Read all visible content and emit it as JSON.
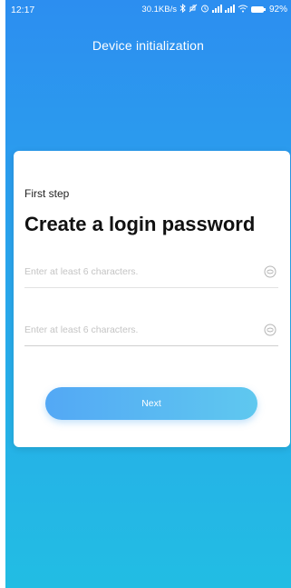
{
  "status_bar": {
    "time": "12:17",
    "network_speed": "30.1KB/s",
    "battery_percent": "92%",
    "icons": [
      "bluetooth-icon",
      "mute-icon",
      "alarm-icon",
      "signal-icon",
      "signal-icon-2",
      "wifi-icon",
      "battery-icon"
    ]
  },
  "header": {
    "title": "Device initialization"
  },
  "card": {
    "step": "First step",
    "title": "Create a login password",
    "password_field": {
      "placeholder": "Enter at least 6 characters.",
      "value": "",
      "icon": "eye-icon"
    },
    "confirm_field": {
      "placeholder": "Enter at least 6 characters.",
      "value": "",
      "icon": "eye-icon"
    },
    "next_label": "Next"
  },
  "colors": {
    "gradient_top": "#2c8ef0",
    "gradient_bottom": "#22bde3",
    "button_start": "#53a8f5",
    "button_end": "#5fc8ef"
  }
}
